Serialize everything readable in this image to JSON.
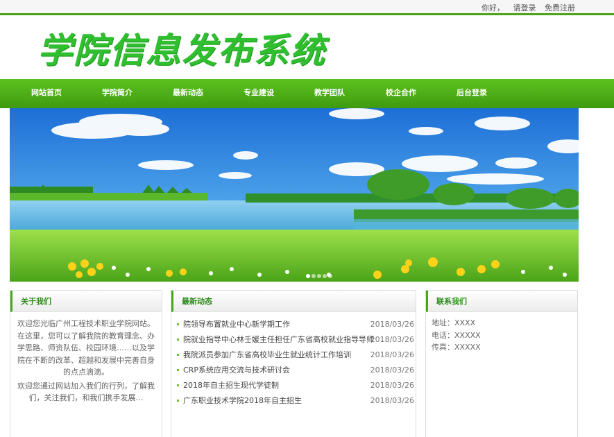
{
  "topbar": {
    "greeting": "你好，",
    "login": "请登录",
    "register": "免费注册"
  },
  "header": {
    "logo_text": "学院信息发布系统"
  },
  "nav": {
    "items": [
      {
        "label": "网站首页"
      },
      {
        "label": "学院简介"
      },
      {
        "label": "最新动态"
      },
      {
        "label": "专业建设"
      },
      {
        "label": "教学团队"
      },
      {
        "label": "校企合作"
      },
      {
        "label": "后台登录"
      }
    ]
  },
  "banner": {
    "slide_count": 5,
    "active_slide": 1
  },
  "about": {
    "title": "关于我们",
    "para1": "欢迎您光临广州工程技术职业学院网站。在这里，您可以了解我院的教育理念、办学思路、师资队伍、校园环境……以及学院在不断的改革、超越和发展中完善自身的点点滴滴。",
    "para2": "欢迎您通过网站加入我们的行列，了解我们，关注我们，和我们携手发展…"
  },
  "news": {
    "title": "最新动态",
    "items": [
      {
        "title": "院领导布置就业中心新学期工作",
        "date": "2018/03/26"
      },
      {
        "title": "院就业指导中心林壬媛主任担任广东省高校就业指导导师",
        "date": "2018/03/26"
      },
      {
        "title": "我院派员参加广东省高校毕业生就业统计工作培训",
        "date": "2018/03/26"
      },
      {
        "title": "CRP系统应用交流与技术研讨会",
        "date": "2018/03/26"
      },
      {
        "title": "2018年自主招生现代学徒制",
        "date": "2018/03/26"
      },
      {
        "title": "广东职业技术学院2018年自主招生",
        "date": "2018/03/26"
      }
    ]
  },
  "contact": {
    "title": "联系我们",
    "address": "地址：XXXX",
    "phone": "电话：XXXXX",
    "fax": "传真：XXXXX"
  },
  "colors": {
    "brand_green": "#48a51c",
    "nav_green_top": "#5cc21f",
    "nav_green_bottom": "#3f9a10",
    "logo_green": "#2fbf2f"
  }
}
